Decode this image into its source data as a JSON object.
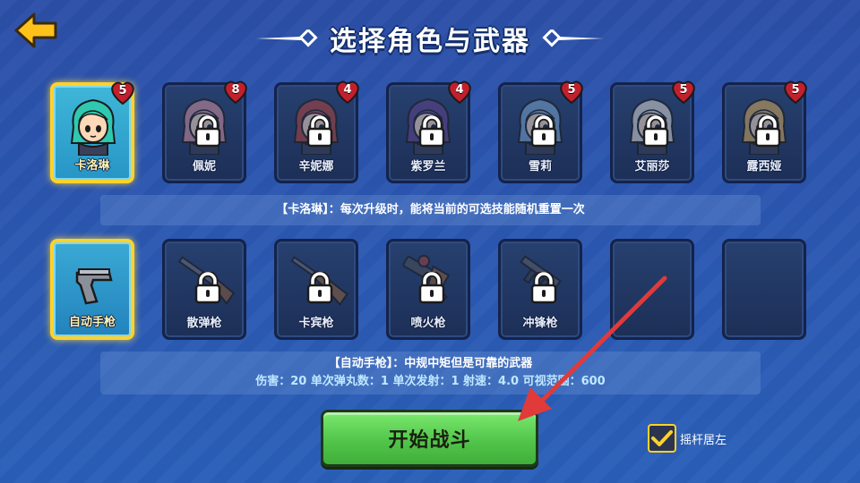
{
  "header": {
    "title": "选择角色与武器",
    "back_icon": "back-arrow-icon"
  },
  "characters": [
    {
      "name": "卡洛琳",
      "level": "5",
      "locked": false,
      "selected": true,
      "hair": "#2fc9b0",
      "face": "#ffd8b8"
    },
    {
      "name": "佩妮",
      "level": "8",
      "locked": true,
      "selected": false,
      "hair": "#e88aa0",
      "face": "#ffd8b8"
    },
    {
      "name": "辛妮娜",
      "level": "4",
      "locked": true,
      "selected": false,
      "hair": "#d8392f",
      "face": "#ffd8b8"
    },
    {
      "name": "紫罗兰",
      "level": "4",
      "locked": true,
      "selected": false,
      "hair": "#6a3ea8",
      "face": "#ffd8b8"
    },
    {
      "name": "雪莉",
      "level": "5",
      "locked": true,
      "selected": false,
      "hair": "#6aa8e8",
      "face": "#ffd8b8"
    },
    {
      "name": "艾丽莎",
      "level": "5",
      "locked": true,
      "selected": false,
      "hair": "#d8d8d0",
      "face": "#ffd8b8"
    },
    {
      "name": "露西娅",
      "level": "5",
      "locked": true,
      "selected": false,
      "hair": "#e8a838",
      "face": "#ffd8b8"
    }
  ],
  "character_info": "【卡洛琳】：每次升级时，能将当前的可选技能随机重置一次",
  "weapons": [
    {
      "name": "自动手枪",
      "locked": false,
      "selected": true,
      "icon": "pistol-icon"
    },
    {
      "name": "散弹枪",
      "locked": true,
      "selected": false,
      "icon": "shotgun-icon"
    },
    {
      "name": "卡宾枪",
      "locked": true,
      "selected": false,
      "icon": "carbine-icon"
    },
    {
      "name": "喷火枪",
      "locked": true,
      "selected": false,
      "icon": "flamethrower-icon"
    },
    {
      "name": "冲锋枪",
      "locked": true,
      "selected": false,
      "icon": "smg-icon"
    },
    {
      "name": "",
      "locked": false,
      "selected": false,
      "icon": ""
    },
    {
      "name": "",
      "locked": false,
      "selected": false,
      "icon": ""
    }
  ],
  "weapon_info": {
    "title": "【自动手枪】：中规中矩但是可靠的武器",
    "stats": "伤害：20  单次弹丸数：1  单次发射：1  射速：4.0  可视范围：600"
  },
  "start_button": "开始战斗",
  "joystick": {
    "label": "摇杆居左",
    "checked": true
  },
  "colors": {
    "background": "#2b57b1",
    "selected_border": "#ffd22a",
    "start_button": "#52c54b",
    "annotation_arrow": "#e03a3a"
  }
}
